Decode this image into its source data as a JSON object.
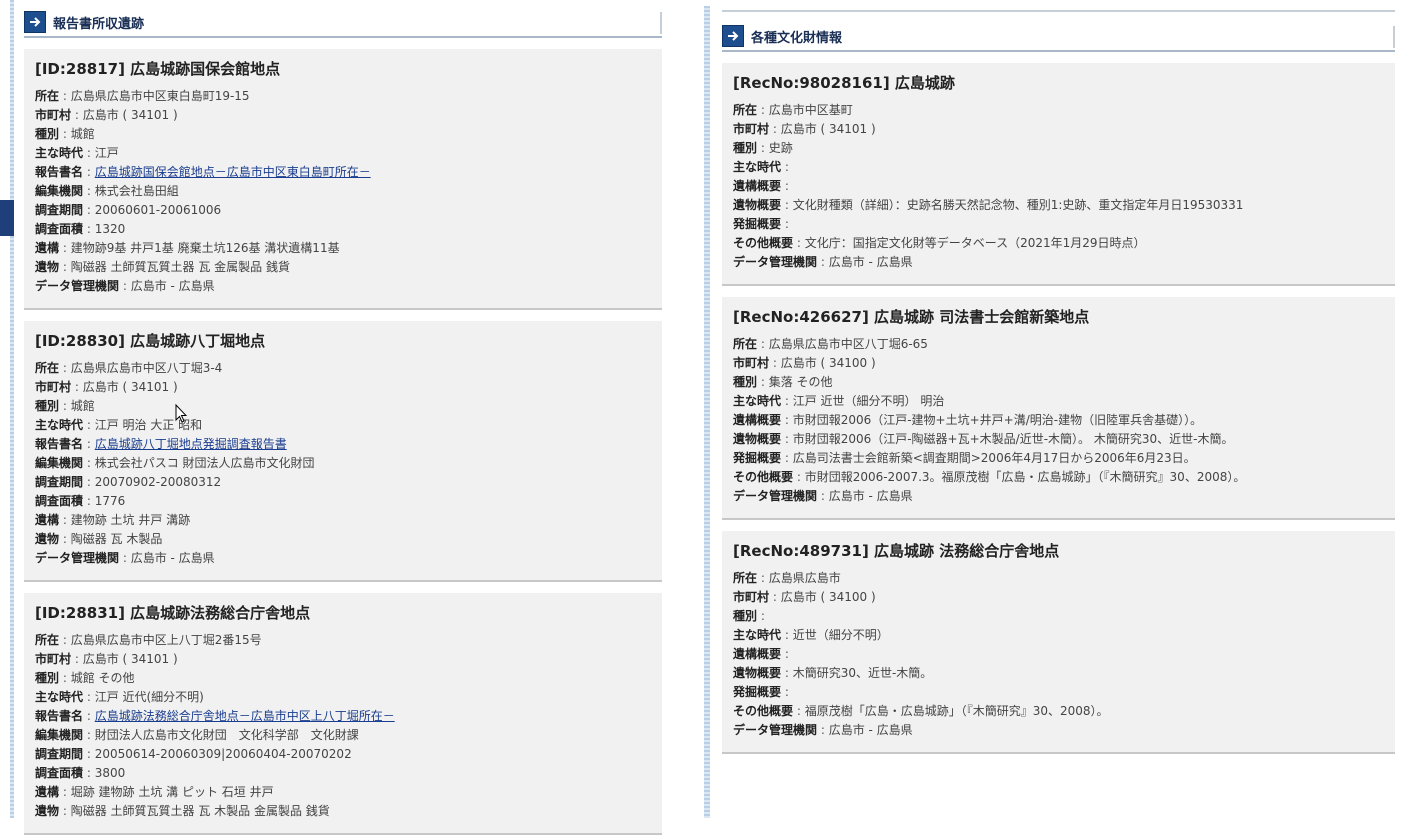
{
  "left_section": {
    "title": "報告書所収遺跡",
    "cards": [
      {
        "title": "[ID:28817] 広島城跡国保会館地点",
        "fields": [
          {
            "label": "所在",
            "value": "広島県広島市中区東白島町19-15"
          },
          {
            "label": "市町村",
            "value": "広島市 ( 34101 )"
          },
          {
            "label": "種別",
            "value": "城館"
          },
          {
            "label": "主な時代",
            "value": "江戸"
          },
          {
            "label": "報告書名",
            "value": "広島城跡国保会館地点－広島市中区東白島町所在－",
            "link": true
          },
          {
            "label": "編集機関",
            "value": "株式会社島田組"
          },
          {
            "label": "調査期間",
            "value": "20060601-20061006"
          },
          {
            "label": "調査面積",
            "value": "1320"
          },
          {
            "label": "遺構",
            "value": "建物跡9基 井戸1基 廃棄土坑126基 溝状遺構11基"
          },
          {
            "label": "遺物",
            "value": "陶磁器 土師質瓦質土器 瓦 金属製品 銭貨"
          },
          {
            "label": "データ管理機関",
            "value": "広島市 - 広島県"
          }
        ]
      },
      {
        "title": "[ID:28830] 広島城跡八丁堀地点",
        "fields": [
          {
            "label": "所在",
            "value": "広島県広島市中区八丁堀3-4"
          },
          {
            "label": "市町村",
            "value": "広島市 ( 34101 )"
          },
          {
            "label": "種別",
            "value": "城館"
          },
          {
            "label": "主な時代",
            "value": "江戸 明治 大正 昭和"
          },
          {
            "label": "報告書名",
            "value": "広島城跡八丁堀地点発掘調査報告書",
            "link": true
          },
          {
            "label": "編集機関",
            "value": "株式会社パスコ 財団法人広島市文化財団"
          },
          {
            "label": "調査期間",
            "value": "20070902-20080312"
          },
          {
            "label": "調査面積",
            "value": "1776"
          },
          {
            "label": "遺構",
            "value": "建物跡 土坑 井戸 溝跡"
          },
          {
            "label": "遺物",
            "value": "陶磁器 瓦 木製品"
          },
          {
            "label": "データ管理機関",
            "value": "広島市 - 広島県"
          }
        ]
      },
      {
        "title": "[ID:28831] 広島城跡法務総合庁舎地点",
        "fields": [
          {
            "label": "所在",
            "value": "広島県広島市中区上八丁堀2番15号"
          },
          {
            "label": "市町村",
            "value": "広島市 ( 34101 )"
          },
          {
            "label": "種別",
            "value": "城館 その他"
          },
          {
            "label": "主な時代",
            "value": "江戸 近代(細分不明)"
          },
          {
            "label": "報告書名",
            "value": "広島城跡法務総合庁舎地点－広島市中区上八丁堀所在－",
            "link": true
          },
          {
            "label": "編集機関",
            "value": "財団法人広島市文化財団　文化科学部　文化財課"
          },
          {
            "label": "調査期間",
            "value": "20050614-20060309|20060404-20070202"
          },
          {
            "label": "調査面積",
            "value": "3800"
          },
          {
            "label": "遺構",
            "value": "堀跡 建物跡 土坑 溝 ピット 石垣 井戸"
          },
          {
            "label": "遺物",
            "value": "陶磁器 土師質瓦質土器 瓦 木製品 金属製品 銭貨"
          }
        ]
      }
    ]
  },
  "right_section": {
    "title": "各種文化財情報",
    "cards": [
      {
        "title": "[RecNo:98028161] 広島城跡",
        "fields": [
          {
            "label": "所在",
            "value": "広島市中区基町"
          },
          {
            "label": "市町村",
            "value": "広島市 ( 34101 )"
          },
          {
            "label": "種別",
            "value": "史跡"
          },
          {
            "label": "主な時代",
            "value": ""
          },
          {
            "label": "遺構概要",
            "value": ""
          },
          {
            "label": "遺物概要",
            "value": "文化財種類（詳細）：史跡名勝天然記念物、種別1:史跡、重文指定年月日19530331"
          },
          {
            "label": "発掘概要",
            "value": ""
          },
          {
            "label": "その他概要",
            "value": "文化庁：国指定文化財等データベース（2021年1月29日時点）"
          },
          {
            "label": "データ管理機関",
            "value": "広島市 - 広島県"
          }
        ]
      },
      {
        "title": "[RecNo:426627] 広島城跡 司法書士会館新築地点",
        "fields": [
          {
            "label": "所在",
            "value": "広島県広島市中区八丁堀6-65"
          },
          {
            "label": "市町村",
            "value": "広島市 ( 34100 )"
          },
          {
            "label": "種別",
            "value": "集落 その他"
          },
          {
            "label": "主な時代",
            "value": "江戸 近世（細分不明） 明治"
          },
          {
            "label": "遺構概要",
            "value": "市財団報2006（江戸-建物+土坑+井戸+溝/明治-建物（旧陸軍兵舎基礎））。"
          },
          {
            "label": "遺物概要",
            "value": "市財団報2006（江戸-陶磁器+瓦+木製品/近世-木簡）。 木簡研究30、近世-木簡。"
          },
          {
            "label": "発掘概要",
            "value": "広島司法書士会館新築<調査期間>2006年4月17日から2006年6月23日。"
          },
          {
            "label": "その他概要",
            "value": "市財団報2006-2007.3。福原茂樹「広島・広島城跡」（『木簡研究』30、2008）。"
          },
          {
            "label": "データ管理機関",
            "value": "広島市 - 広島県"
          }
        ]
      },
      {
        "title": "[RecNo:489731] 広島城跡 法務総合庁舎地点",
        "fields": [
          {
            "label": "所在",
            "value": "広島県広島市"
          },
          {
            "label": "市町村",
            "value": "広島市 ( 34100 )"
          },
          {
            "label": "種別",
            "value": ""
          },
          {
            "label": "主な時代",
            "value": "近世（細分不明）"
          },
          {
            "label": "遺構概要",
            "value": ""
          },
          {
            "label": "遺物概要",
            "value": "木簡研究30、近世-木簡。"
          },
          {
            "label": "発掘概要",
            "value": ""
          },
          {
            "label": "その他概要",
            "value": "福原茂樹「広島・広島城跡」（『木簡研究』30、2008）。"
          },
          {
            "label": "データ管理機関",
            "value": "広島市 - 広島県"
          }
        ]
      }
    ]
  },
  "theme": {
    "accent": "#1d4f8e",
    "link": "#1a3d8f",
    "card_bg": "#f1f1f1"
  },
  "icons": {
    "section_header": "arrow-right-icon",
    "cursor": "mouse-pointer-icon"
  }
}
